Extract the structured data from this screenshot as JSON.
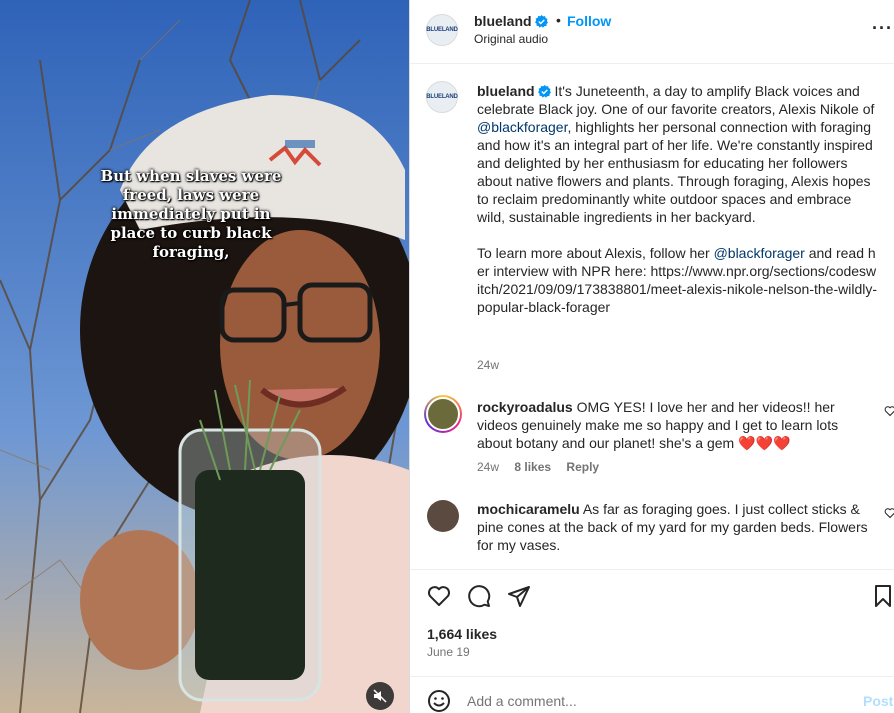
{
  "video": {
    "caption": "But when slaves were\nfreed, laws were\nimmediately put in\nplace to curb black\nforaging,",
    "mute_icon": "speaker-muted-icon"
  },
  "header": {
    "username": "blueland",
    "avatar_text": "BLUELAND",
    "dot": "•",
    "follow_label": "Follow",
    "audio_label": "Original audio",
    "more_label": "···"
  },
  "caption": {
    "username": "blueland",
    "text_1": " It's Juneteenth, a day to amplify Black voices and celebrate Black joy. One of our favorite creators, Alexis Nikole of ",
    "mention_1": "@blackforager",
    "text_2": ", highlights her personal connection with foraging and how it's an integral part of her life. We're constantly inspired and delighted by her enthusiasm for educating her followers about native flowers and plants. Through foraging, Alexis hopes to reclaim predominantly white outdoor spaces and embrace wild, sustainable ingredients in her backyard.",
    "text_3": "To learn more about Alexis, follow her ",
    "mention_2": "@blackforager",
    "text_4": " and read her interview with NPR here: https://www.npr.org/sections/codeswitch/2021/09/09/173838801/meet-alexis-nikole-nelson-the-wildly-popular-black-forager",
    "time": "24w"
  },
  "comments": [
    {
      "username": "rockyroadalus",
      "text": " OMG YES! I love her and her videos!! her videos genuinely make me so happy and I get to learn lots about botany and our planet! she's a gem ❤️❤️❤️",
      "time": "24w",
      "likes": "8 likes",
      "reply": "Reply"
    },
    {
      "username": "mochicaramelu",
      "text": " As far as foraging goes. I just collect sticks & pine cones at the back of my yard for my garden beds. Flowers for my vases."
    }
  ],
  "footer": {
    "likes": "1,664 likes",
    "date": "June 19",
    "comment_placeholder": "Add a comment...",
    "post_label": "Post",
    "icons": [
      "heart-icon",
      "comment-icon",
      "share-icon",
      "bookmark-icon",
      "emoji-icon"
    ]
  },
  "colors": {
    "accent": "#0095f6",
    "mention": "#00376b",
    "post_disabled": "#b2dffc"
  }
}
